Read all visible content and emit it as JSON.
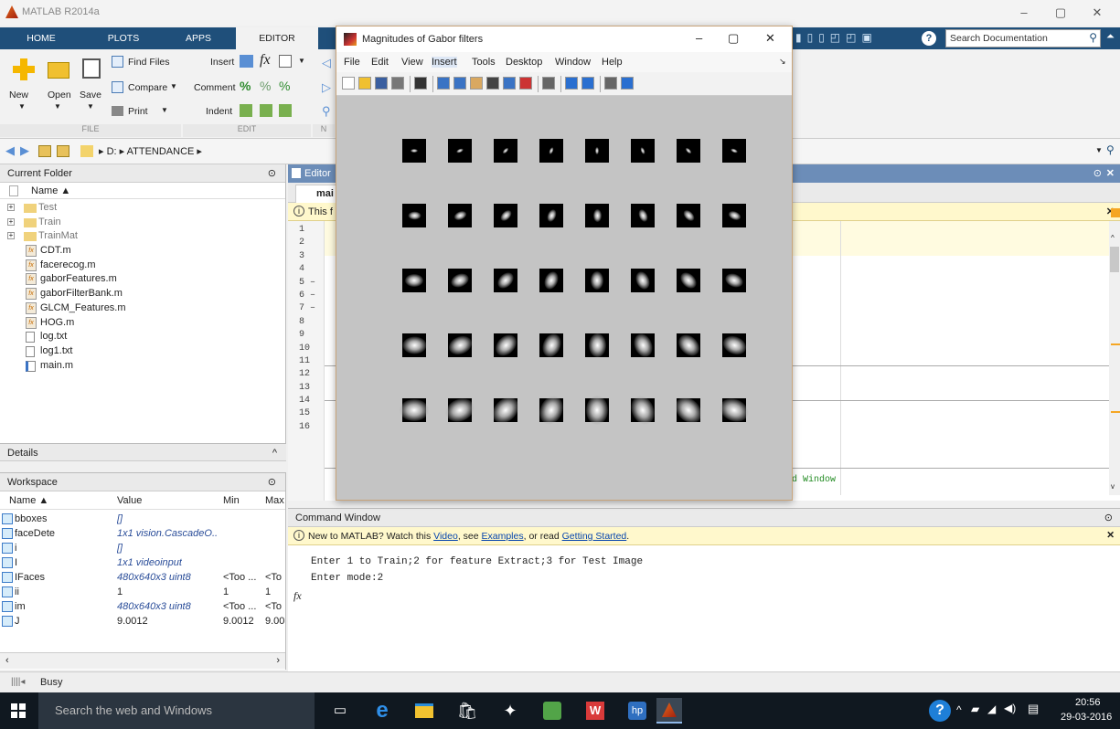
{
  "app_title": "MATLAB R2014a",
  "ribbon": {
    "tabs": [
      "HOME",
      "PLOTS",
      "APPS",
      "EDITOR"
    ],
    "buttons": {
      "new": "New",
      "open": "Open",
      "save": "Save",
      "find_files": "Find Files",
      "compare": "Compare",
      "print": "Print",
      "insert": "Insert",
      "comment": "Comment",
      "indent": "Indent"
    },
    "groups": {
      "file": "FILE",
      "edit": "EDIT",
      "nav": "N"
    },
    "search_placeholder": "Search Documentation"
  },
  "address": {
    "path": "▸ D: ▸ ATTENDANCE ▸"
  },
  "current_folder": {
    "title": "Current Folder",
    "column": "Name ▲",
    "items": [
      {
        "name": "Test",
        "type": "folder"
      },
      {
        "name": "Train",
        "type": "folder"
      },
      {
        "name": "TrainMat",
        "type": "folder"
      },
      {
        "name": "CDT.m",
        "type": "func"
      },
      {
        "name": "facerecog.m",
        "type": "func"
      },
      {
        "name": "gaborFeatures.m",
        "type": "func"
      },
      {
        "name": "gaborFilterBank.m",
        "type": "func"
      },
      {
        "name": "GLCM_Features.m",
        "type": "func"
      },
      {
        "name": "HOG.m",
        "type": "func"
      },
      {
        "name": "log.txt",
        "type": "txt"
      },
      {
        "name": "log1.txt",
        "type": "txt"
      },
      {
        "name": "main.m",
        "type": "script"
      }
    ]
  },
  "details": {
    "title": "Details"
  },
  "workspace": {
    "title": "Workspace",
    "columns": [
      "Name ▲",
      "Value",
      "Min",
      "Max"
    ],
    "rows": [
      {
        "name": "bboxes",
        "value": "[]",
        "min": "",
        "max": "",
        "italic": true
      },
      {
        "name": "faceDetector",
        "value": "1x1 vision.CascadeO...",
        "min": "",
        "max": "",
        "italic": true
      },
      {
        "name": "i",
        "value": "[]",
        "min": "",
        "max": "",
        "italic": true
      },
      {
        "name": "I",
        "value": "1x1 videoinput",
        "min": "",
        "max": "",
        "italic": true
      },
      {
        "name": "IFaces",
        "value": "480x640x3 uint8",
        "min": "<Too ...",
        "max": "<To",
        "italic": true
      },
      {
        "name": "ii",
        "value": "1",
        "min": "1",
        "max": "1",
        "italic": false
      },
      {
        "name": "im",
        "value": "480x640x3 uint8",
        "min": "<Too ...",
        "max": "<To",
        "italic": true
      },
      {
        "name": "J",
        "value": "9.0012",
        "min": "9.0012",
        "max": "9.00",
        "italic": false
      }
    ]
  },
  "editor": {
    "title": "Editor",
    "tab": "mai",
    "info": "This f",
    "line_numbers": [
      "1",
      "2",
      "3",
      "4",
      "5 –",
      "6 –",
      "7 –",
      "8",
      "9",
      "10",
      "11",
      "12",
      "13",
      "14",
      "15",
      "16"
    ],
    "visible_code": "nd Window"
  },
  "figure": {
    "title": "Magnitudes of Gabor filters",
    "menu": [
      "File",
      "Edit",
      "View",
      "Insert",
      "Tools",
      "Desktop",
      "Window",
      "Help"
    ],
    "grid_rows": 5,
    "grid_cols": 8
  },
  "command_window": {
    "title": "Command Window",
    "notice_prefix": "New to MATLAB? Watch this ",
    "notice_video": "Video",
    "notice_mid": ", see ",
    "notice_examples": "Examples",
    "notice_mid2": ", or read ",
    "notice_started": "Getting Started",
    "notice_end": ".",
    "lines": [
      "Enter 1 to Train;2 for feature Extract;3 for Test Image",
      "Enter mode:2"
    ],
    "prompt": "fx"
  },
  "status": {
    "text": "Busy"
  },
  "taskbar": {
    "search_placeholder": "Search the web and Windows",
    "time": "20:56",
    "date": "29-03-2016"
  },
  "colors": {
    "ribbon_bg": "#1f4f7a",
    "taskbar_bg": "#101820",
    "figure_bg": "#c4c4c4"
  }
}
